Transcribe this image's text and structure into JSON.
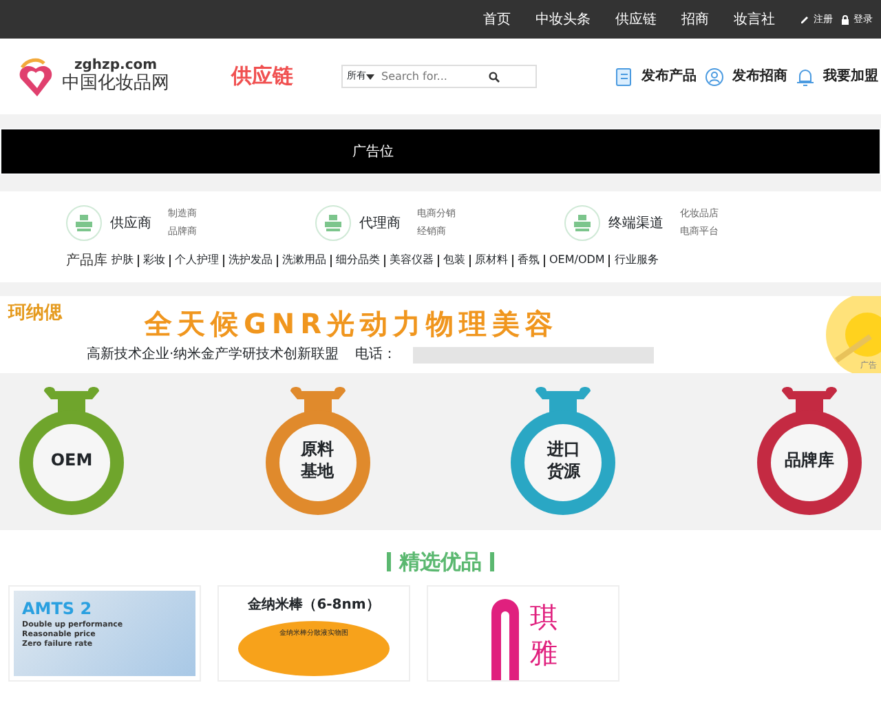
{
  "top_nav": {
    "links": [
      "首页",
      "中妆头条",
      "供应链",
      "招商",
      "妆言社"
    ],
    "register": "注册",
    "login": "登录"
  },
  "header": {
    "domain": "zghzp.com",
    "site_name": "中国化妆品网",
    "section_title": "供应链",
    "search": {
      "scope": "所有",
      "placeholder": "Search for..."
    },
    "actions": [
      {
        "kind": "product",
        "label": "发布产品"
      },
      {
        "kind": "user",
        "label": "发布招商"
      },
      {
        "kind": "bell",
        "label": "我要加盟"
      }
    ]
  },
  "ad_slot": {
    "label": "广告位"
  },
  "categories": [
    {
      "title": "供应商",
      "subs": [
        "制造商",
        "品牌商"
      ]
    },
    {
      "title": "代理商",
      "subs": [
        "电商分销",
        "经销商"
      ]
    },
    {
      "title": "终端渠道",
      "subs": [
        "化妆品店",
        "电商平台"
      ]
    }
  ],
  "product_library": {
    "label": "产品库",
    "items": [
      "护肤",
      "彩妆",
      "个人护理",
      "洗护发品",
      "洗漱用品",
      "细分品类",
      "美容仪器",
      "包装",
      "原材料",
      "香氛",
      "OEM/ODM",
      "行业服务"
    ]
  },
  "banner": {
    "brand": "珂纳偲",
    "headline": "全天候GNR光动力物理美容",
    "tagline": "高新技术企业·纳米金产学研技术创新联盟",
    "phone_label": "电话：",
    "ad_tag": "广告"
  },
  "badges": [
    {
      "lines": [
        "OEM"
      ],
      "color": "#6fa52c"
    },
    {
      "lines": [
        "原料",
        "基地"
      ],
      "color": "#e08a2c"
    },
    {
      "lines": [
        "进口",
        "货源"
      ],
      "color": "#2aa7c4"
    },
    {
      "lines": [
        "品牌库"
      ],
      "color": "#c42a42"
    }
  ],
  "featured": {
    "title": "精选优品",
    "cards": [
      {
        "kind": "device",
        "texts": [
          "AMTS 2",
          "Double up performance",
          "Reasonable price",
          "Zero failure rate"
        ]
      },
      {
        "kind": "nanorod",
        "texts": [
          "金纳米棒（6-8nm）",
          "金纳米棒分散液实物图"
        ]
      },
      {
        "kind": "logo",
        "texts": [
          "琪",
          "雅"
        ]
      }
    ]
  }
}
